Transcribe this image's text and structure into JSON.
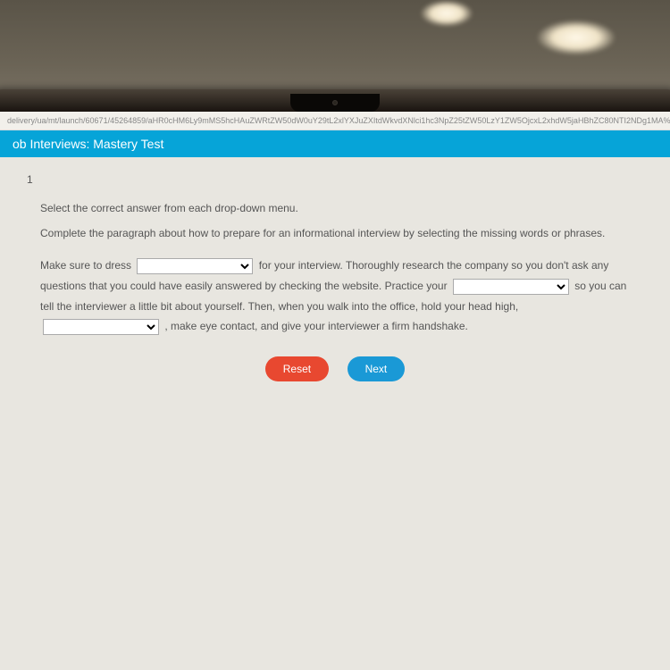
{
  "url": "delivery/ua/mt/launch/60671/45264859/aHR0cHM6Ly9mMS5hcHAuZWRtZW50dW0uY29tL2xlYXJuZXItdWkvdXNlci1hc3NpZ25tZW50LzY1ZW5OjcxL2xhdW5jaHBhZC80NTI2NDg1MA%3d",
  "header": {
    "title": "ob Interviews: Mastery Test"
  },
  "question": {
    "number": "1",
    "instruction": "Select the correct answer from each drop-down menu.",
    "subinstruction": "Complete the paragraph about how to prepare for an informational interview by selecting the missing words or phrases.",
    "text": {
      "p1a": "Make sure to dress ",
      "p1b": " for your interview. Thoroughly research the company so you don't ask any questions that you could have easily answered by checking the website. Practice your ",
      "p1c": " so you can tell the interviewer a little bit about yourself. Then, when you walk into the office, hold your head high, ",
      "p1d": " , make eye contact, and give your interviewer a firm handshake."
    }
  },
  "buttons": {
    "reset": "Reset",
    "next": "Next"
  }
}
